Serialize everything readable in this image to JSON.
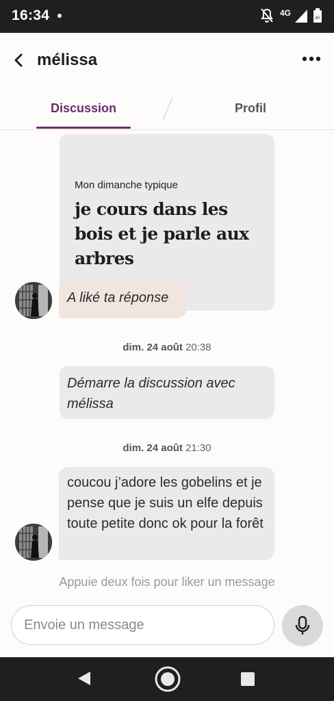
{
  "status_bar": {
    "time": "16:34",
    "network": "4G",
    "battery_level": "80",
    "icons": [
      "notification-dot",
      "mute-icon",
      "signal-icon",
      "battery-icon"
    ]
  },
  "header": {
    "back_icon": "chevron-left-icon",
    "contact_name": "mélissa",
    "more_icon": "more-horizontal-icon"
  },
  "tabs": [
    {
      "label": "Discussion",
      "active": true
    },
    {
      "label": "Profil",
      "active": false
    }
  ],
  "colors": {
    "accent": "#6a2a6a",
    "bubble": "#eaeaea",
    "like_bubble": "#f2e4df",
    "background": "#fdfcfb",
    "system_bar": "#1f1f1f"
  },
  "conversation": {
    "liked_card": {
      "prompt": "Mon dimanche typique",
      "answer": "je cours dans les bois et je parle aux arbres"
    },
    "like_message": "A liké ta réponse",
    "timestamp_1": {
      "date": "dim. 24 août",
      "time": "20:38"
    },
    "system_message": "Démarre la discussion avec mélissa",
    "timestamp_2": {
      "date": "dim. 24 août",
      "time": "21:30"
    },
    "message": "coucou j’adore les gobelins et je pense que je suis un elfe depuis toute petite donc ok pour la forêt"
  },
  "hint": "Appuie deux fois pour liker un message",
  "composer": {
    "placeholder": "Envoie un message",
    "mic_icon": "microphone-icon"
  },
  "nav_bar": {
    "icons": [
      "nav-back-icon",
      "nav-home-icon",
      "nav-recents-icon"
    ]
  }
}
